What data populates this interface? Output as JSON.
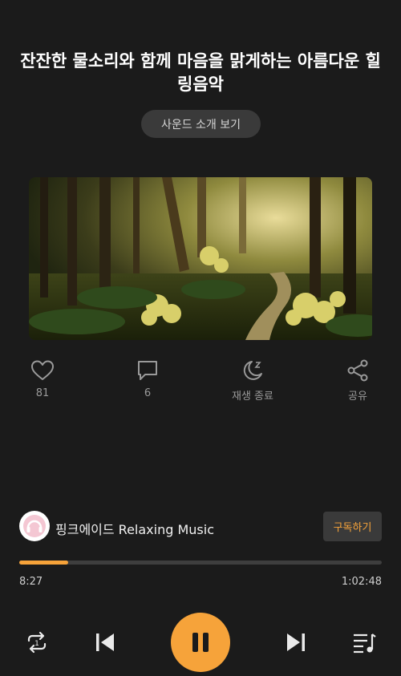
{
  "title": "잔잔한 물소리와 함께 마음을 맑게하는 아름다운 힐링음악",
  "intro_button": "사운드 소개 보기",
  "actions": {
    "like_count": "81",
    "comment_count": "6",
    "sleep_label": "재생 종료",
    "share_label": "공유"
  },
  "channel": {
    "name": "핑크에이드 Relaxing Music",
    "subscribe_label": "구독하기"
  },
  "player": {
    "elapsed": "8:27",
    "duration": "1:02:48",
    "progress_fraction": 0.135,
    "state": "playing"
  },
  "colors": {
    "accent": "#f6a33a",
    "background": "#1b1b1b"
  },
  "icons": [
    "heart-icon",
    "comment-icon",
    "sleep-timer-icon",
    "share-icon",
    "repeat-icon",
    "previous-icon",
    "pause-icon",
    "next-icon",
    "playlist-icon"
  ]
}
